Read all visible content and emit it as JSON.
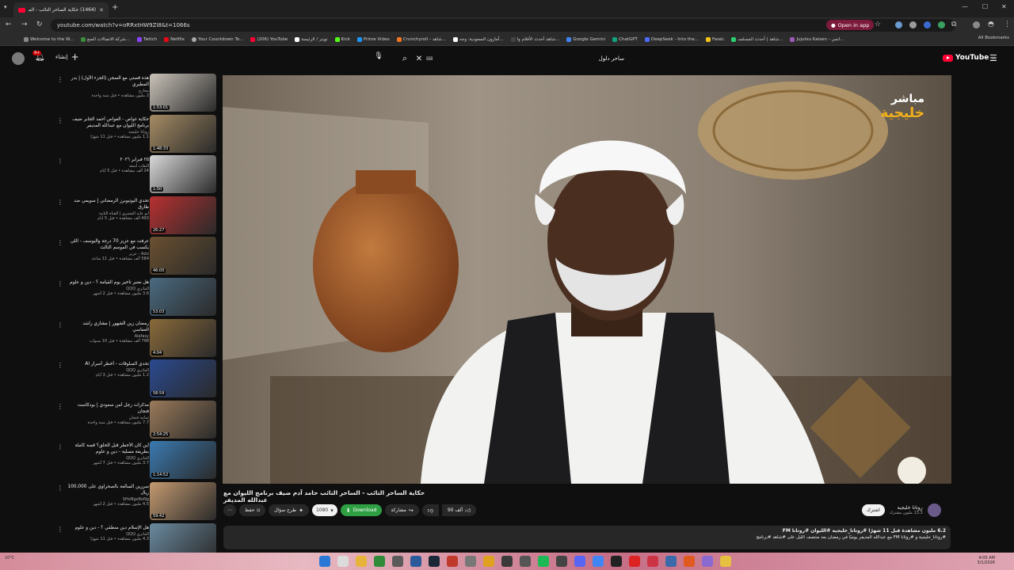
{
  "browser": {
    "tab_title": "(1464) حكاية الساحر التائب - الس",
    "url": "youtube.com/watch?v=oRRxtHW9ZI8&t=1066s",
    "open_in_app": "Open in app",
    "bookmarks": [
      "Welcome to the W...",
      "شركة الاتصالات السع...",
      "Twitch",
      "Netflix",
      "Your Countdown To...",
      "(206) YouTube",
      "تويتر / الرئيسة",
      "Kick",
      "Prime Video",
      "Crunchyroll - شاهد...",
      "أمازون السعودية: وجه...",
      "شاهد أحدث الأفلام وا...",
      "Google Gemini",
      "ChatGPT",
      "DeepSeek - Into the...",
      "Faselـ",
      "شاهد | أحدث المسلسـ...",
      "Jujutsu Kaisen - انمي..."
    ],
    "all_bookmarks": "All Bookmarks"
  },
  "youtube": {
    "notification_count": "9+",
    "create_label": "إنشاء",
    "search_query": "ساحر دلول",
    "logo_text": "YouTube",
    "logo_region": "SA"
  },
  "player": {
    "watermark_live": "مباشر",
    "watermark_brand": "خليجية"
  },
  "video": {
    "title": "حكاية الساحر التائب - الساحر التائب حامد آدم ضيف برنامج الليوان مع عبدالله المديفر",
    "likes": "90 ألف",
    "share": "مشاركة",
    "download": "Download",
    "quality": "1080",
    "ask": "طرح سؤال",
    "save": "حفظ",
    "channel_name": "روتانا خليجية",
    "channel_subs": "13.3 مليون مشترك",
    "subscribe": "اشترك",
    "desc_line1": "6.2 مليون مشاهدة  قبل 11 شهرًا  #روتانا_خليجية #الليوان #روتانا FM",
    "desc_line2": "#روتانا_خليجية و #روتانا FM مع عبدالله المديفر يوميًا في رمضان بعد منتصف الليل على #شاهد #برنامج"
  },
  "related": [
    {
      "title": "هذه قصتي مع السجن (الجزء الأول) | بدر المطيري",
      "channel": "مخارج",
      "stats": "2 مليون مشاهدة • قبل سنة واحدة",
      "duration": "1:53:01",
      "color": "#c9c2b8"
    },
    {
      "title": "حكاية غواص - الغواص أحمد الجابر ضيف برنامج الليوان مع عبدالله المديفر",
      "channel": "روتانا خليجية",
      "stats": "1.1 مليون مشاهدة • قبل 11 شهرًا",
      "duration": "1:48:33",
      "color": "#a58b63"
    },
    {
      "title": "٢٥ فبراير ٢٠٢٦",
      "channel": "النقاب أسعد",
      "stats": "24 ألف مشاهدة • قبل 5 أيام",
      "duration": "1:50",
      "color": "#d9d9d9"
    },
    {
      "title": "تحدي اليوتيوبرز الرمضاني | سويمي ضد طارق",
      "channel": "أبو عابد الشمري | القناة الثانية",
      "stats": "493 ألف مشاهدة • قبل 5 أيام",
      "duration": "26:27",
      "color": "#b83030"
    },
    {
      "title": "عرفت مع عزيز 70 درجة واليوسف - اللي يكسب في الموسم الثالث",
      "channel": "Aziz - عزيز",
      "stats": "584 ألف مشاهدة • قبل 11 ساعة",
      "duration": "46:00",
      "color": "#6a5030"
    },
    {
      "title": "هل نعتبر تأخير يوم القيامة ؟ - دين و علوم",
      "channel": "الماتري QQQ",
      "stats": "3.6 مليون مشاهدة • قبل 2 أشهر",
      "duration": "53:03",
      "color": "#4a6a80"
    },
    {
      "title": "رمضان زين الشهور | مشاري راشد العفاسي",
      "channel": "Alafasy",
      "stats": "798 ألف مشاهدة • قبل 10 سنوات",
      "duration": "4:04",
      "color": "#8a6a3a"
    },
    {
      "title": "تحدي السلوقات - أخطر أسرار AI",
      "channel": "الماتري QQQ",
      "stats": "1.2 مليون مشاهدة • قبل 3 أيام",
      "duration": "58:59",
      "color": "#2a4a90"
    },
    {
      "title": "مذكرات رجل أمن سعودي | بودكاست فنجان",
      "channel": "ثمانية فنجان",
      "stats": "7.7 مليون مشاهدة • قبل سنة واحدة",
      "duration": "2:54:25",
      "color": "#9a7a5a"
    },
    {
      "title": "أين كان الأخطر قبل الخلق؟ قصة كاملة بطريقة مسلية - دين و علوم",
      "channel": "الماتري QQQ",
      "stats": "3.7 مليون مشاهدة • قبل 7 أشهر",
      "duration": "1:14:52",
      "color": "#3a7ab0"
    },
    {
      "title": "سررين السالعة بالصحراوي على 100,000 ريال",
      "channel": "SHoNgxBoNg",
      "stats": "4.5 مليون مشاهدة • قبل 2 أشهر",
      "duration": "59:42",
      "color": "#c49a70"
    },
    {
      "title": "هل الإسلام دين منطقي ؟ - دين و علوم",
      "channel": "الماتري QQQ",
      "stats": "4.3 مليون مشاهدة • قبل 11 شهرًا",
      "duration": "",
      "color": "#6a8aa0"
    }
  ],
  "taskbar": {
    "weather": "10°C",
    "time": "4:05 AM",
    "date": "3/1/2026"
  }
}
